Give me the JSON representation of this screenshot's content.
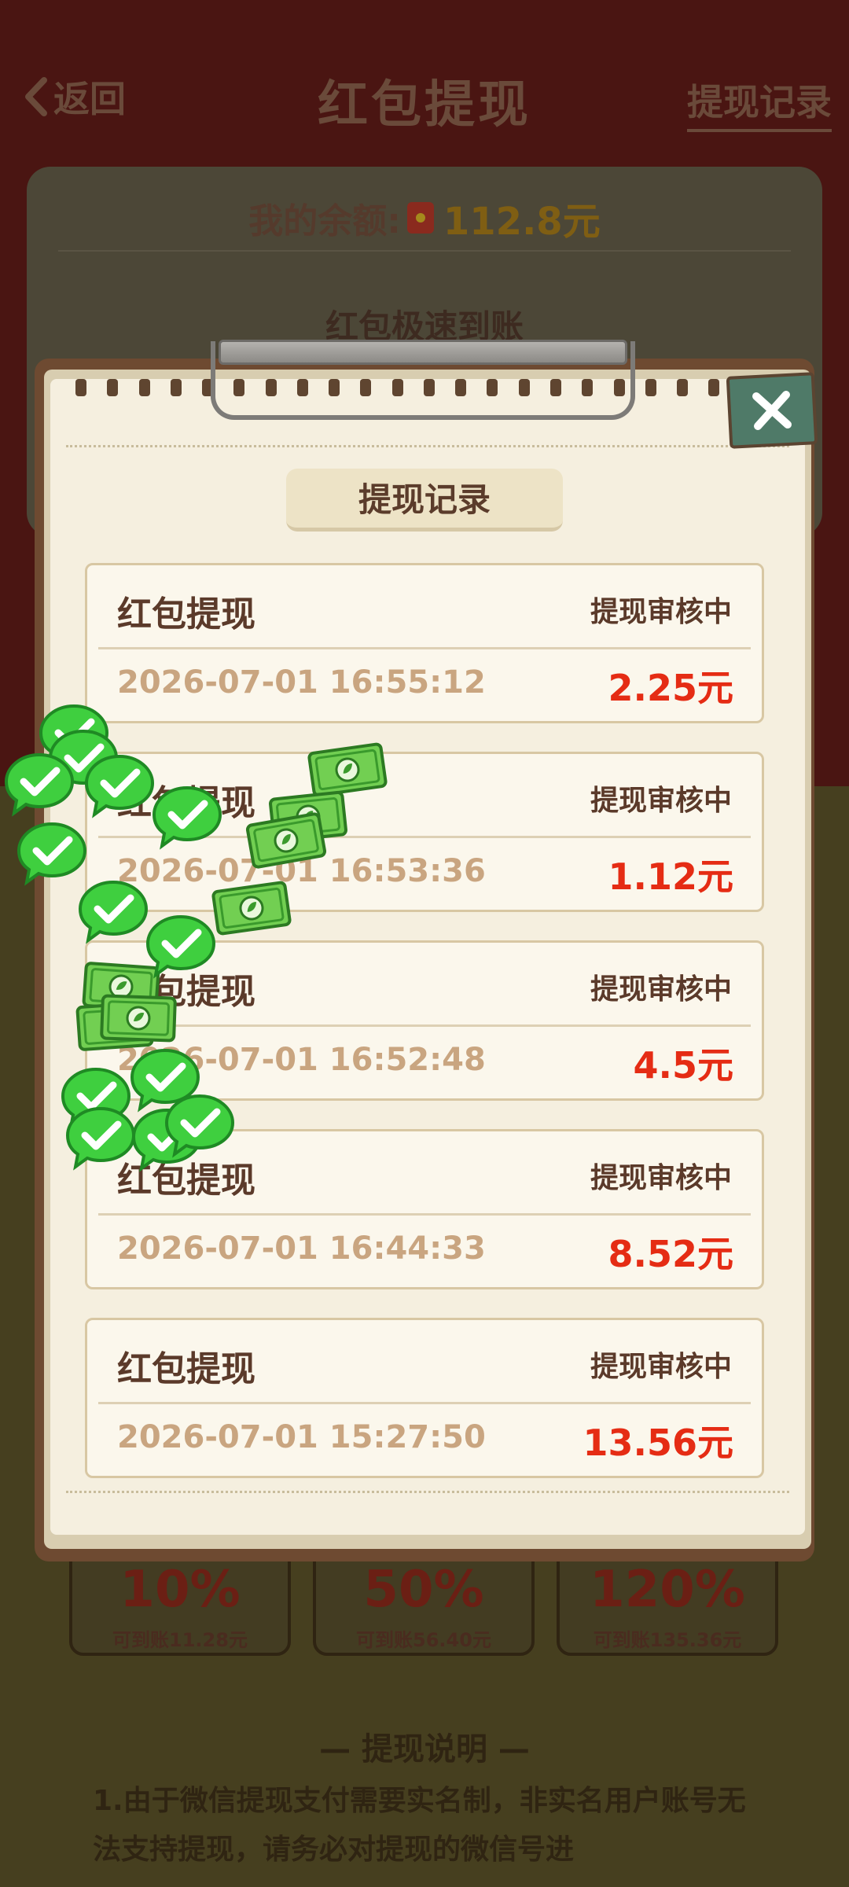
{
  "header": {
    "back_label": "返回",
    "title": "红包提现",
    "records_link": "提现记录"
  },
  "balance": {
    "label": "我的余额:",
    "amount": "112.8元",
    "fast_arrive": "红包极速到账"
  },
  "modal": {
    "title": "提现记录",
    "records": [
      {
        "title": "红包提现",
        "status": "提现审核中",
        "time": "2026-07-01 16:55:12",
        "amount": "2.25元"
      },
      {
        "title": "红包提现",
        "status": "提现审核中",
        "time": "2026-07-01 16:53:36",
        "amount": "1.12元"
      },
      {
        "title": "红包提现",
        "status": "提现审核中",
        "time": "2026-07-01 16:52:48",
        "amount": "4.5元"
      },
      {
        "title": "红包提现",
        "status": "提现审核中",
        "time": "2026-07-01 16:44:33",
        "amount": "8.52元"
      },
      {
        "title": "红包提现",
        "status": "提现审核中",
        "time": "2026-07-01 15:27:50",
        "amount": "13.56元"
      }
    ]
  },
  "options": [
    {
      "percent": "10%",
      "desc": "可到账11.28元"
    },
    {
      "percent": "50%",
      "desc": "可到账56.40元"
    },
    {
      "percent": "120%",
      "desc": "可到账135.36元"
    }
  ],
  "explain": {
    "title": "— 提现说明 —",
    "text": "1.由于微信提现支付需要实名制，非实名用户账号无法支持提现，请务必对提现的微信号进"
  },
  "icons": {
    "back": "chevron-left-icon",
    "close": "close-icon",
    "wechat": "wechat-check-icon",
    "cash": "cash-bill-icon"
  },
  "colors": {
    "amount_red": "#e52c14",
    "paper": "#f5efdf",
    "close_green": "#4f7a68"
  }
}
